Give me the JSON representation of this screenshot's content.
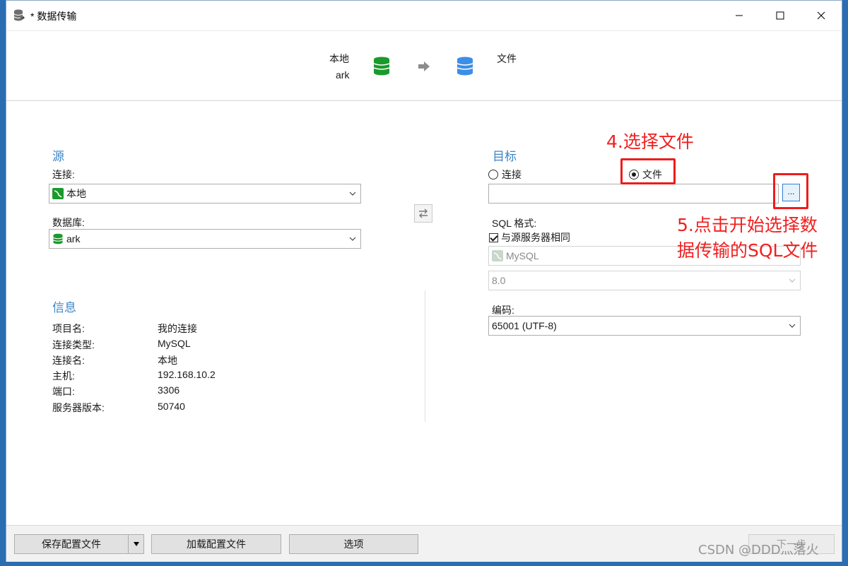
{
  "window": {
    "title": "* 数据传输"
  },
  "header": {
    "source_name": "本地",
    "source_db": "ark",
    "target_name": "文件",
    "source_icon": "green-database-icon",
    "target_icon": "blue-database-icon",
    "arrow_icon": "right-arrow-icon"
  },
  "source": {
    "title": "源",
    "connection_label": "连接:",
    "connection_value": "本地",
    "database_label": "数据库:",
    "database_value": "ark"
  },
  "info": {
    "title": "信息",
    "rows": [
      {
        "key": "项目名:",
        "value": "我的连接"
      },
      {
        "key": "连接类型:",
        "value": "MySQL"
      },
      {
        "key": "连接名:",
        "value": "本地"
      },
      {
        "key": "主机:",
        "value": "192.168.10.2"
      },
      {
        "key": "端口:",
        "value": "3306"
      },
      {
        "key": "服务器版本:",
        "value": "50740"
      }
    ]
  },
  "target": {
    "title": "目标",
    "radio_connection": "连接",
    "radio_file": "文件",
    "selected": "文件",
    "file_path": "",
    "browse_label": "...",
    "sql_format_label": "SQL 格式:",
    "same_as_source_label": "与源服务器相同",
    "same_as_source_checked": true,
    "format_value": "MySQL",
    "version_value": "8.0",
    "encoding_label": "编码:",
    "encoding_value": "65001 (UTF-8)"
  },
  "annotations": {
    "step4": "4.选择文件",
    "step5_line1": "5.点击开始选择数",
    "step5_line2": "据传输的SQL文件"
  },
  "footer": {
    "save_config": "保存配置文件",
    "load_config": "加载配置文件",
    "options": "选项",
    "next": "下一步"
  },
  "watermark": "CSDN @DDD灬落火",
  "colors": {
    "accent": "#3d85c6",
    "annotation_red": "#ee1c1c",
    "green_db": "#1a9a2c",
    "blue_db": "#3d8ee6"
  }
}
